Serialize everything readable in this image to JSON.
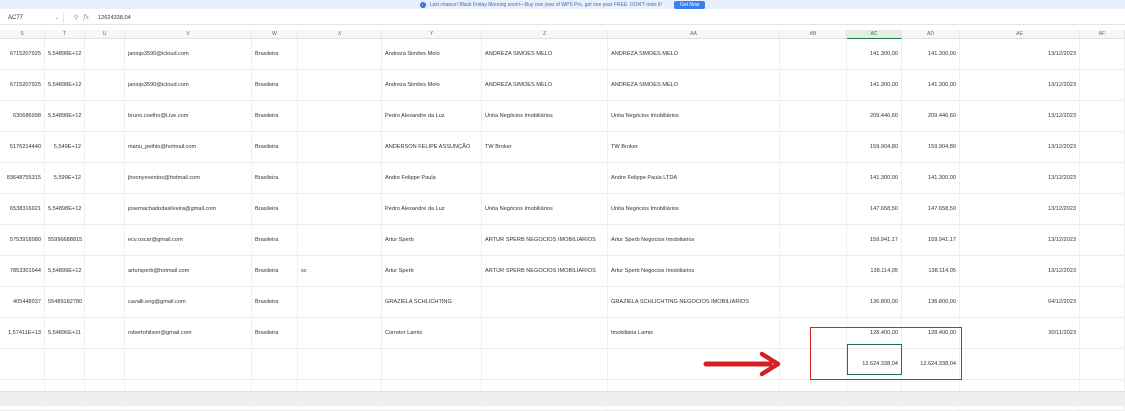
{
  "promo": {
    "text": "Last chance! Black Friday Mooring soon!—Buy one year of WPS Pro, get one year FREE. DON'T miss it!",
    "button": "Get Now"
  },
  "formula": {
    "cell_ref": "AC77",
    "fx": "fx",
    "value": "12624338,04"
  },
  "columns": [
    "S",
    "T",
    "U",
    "V",
    "W",
    "X",
    "Y",
    "Z",
    "AA",
    "AB",
    "AC",
    "AD",
    "AE",
    "AF"
  ],
  "active_column": "AC",
  "rows": [
    [
      "6715207925",
      "5,54898E+12",
      "",
      "janiojs3590@icloud.com",
      "Brasileira",
      "",
      "Andreza Simões Melo",
      "ANDREZA SIMOES MELO",
      "ANDREZA SIMOES MELO",
      "",
      "141.300,00",
      "141.300,00",
      "13/12/2023",
      ""
    ],
    [
      "6715207925",
      "5,54898E+12",
      "",
      "janiojs3590@icloud.com",
      "Brasileira",
      "",
      "Andreza Simões Melo",
      "ANDREZA SIMOES MELO",
      "ANDREZA SIMOES MELO",
      "",
      "141.300,00",
      "141.300,00",
      "13/12/2023",
      ""
    ],
    [
      "630686998",
      "5,54898E+12",
      "",
      "bruno.coelho@Live.com",
      "Brasileira",
      "",
      "Pedro Alexandre da Luz",
      "Unita Negócios Imobiliários",
      "Unita Negócios Imobiliários",
      "",
      "209.446,60",
      "209.446,60",
      "13/12/2023",
      ""
    ],
    [
      "5176214440",
      "5,549E+12",
      "",
      "manu_pethio@hotmail.com",
      "Brasileira",
      "",
      "ANDERSON FELIPE ASSUNÇÃO",
      "TW Broker",
      "TW Broker",
      "",
      "159.904,80",
      "159.904,80",
      "13/12/2023",
      ""
    ],
    [
      "83648755315",
      "5,599E+12",
      "",
      "jhoonyeventos@hotmail.com",
      "Brasileira",
      "",
      "Andre Felippe Paula",
      "",
      "Andre Felippe Paula LTDA",
      "",
      "141.300,00",
      "141.300,00",
      "13/12/2023",
      ""
    ],
    [
      "6538316921",
      "5,54898E+12",
      "",
      "josemachadodasilveira@gmail.com",
      "Brasileira",
      "",
      "Pedro Alexandre da Luz",
      "Unita Negócios Imobiliários",
      "Unita Negócios Imobiliários",
      "",
      "147.658,50",
      "147.658,50",
      "13/12/2023",
      ""
    ],
    [
      "5753918980",
      "55996688815",
      "",
      "ecv.oscar@gmail.com",
      "Brasileira",
      "",
      "Artur Sperb",
      "ARTUR SPERB NEGOCIOS IMOBILIARIOS",
      "Artur Sperb Negocios Imobiliarios",
      "",
      "159.941,17",
      "159.941,17",
      "13/12/2023",
      ""
    ],
    [
      "7853301944",
      "5,54899E+12",
      "",
      "artursperb@hotmail.com",
      "Brasileira",
      "sc",
      "Artur Sperb",
      "ARTUR SPERB NEGOCIOS IMOBILIARIOS",
      "Artur Sperb Negocios Imobiliarios",
      "",
      "138.114,05",
      "138.114,05",
      "13/12/2023",
      ""
    ],
    [
      "405448937",
      "55489182780",
      "",
      "cavalli.eng@gmail.com",
      "Brasileira",
      "",
      "GRAZIELA SCHLICHTING",
      "",
      "GRAZIELA SCHLICHTING NEGOCIOS IMOBILIARIOS",
      "",
      "136.800,00",
      "136.800,00",
      "04/12/2023",
      ""
    ],
    [
      "1,57411E+13",
      "5,54896E+11",
      "",
      "robertohilson@gmail.com",
      "Brasileira",
      "",
      "Corretor Lamis",
      "",
      "Imobiliária Lamis",
      "",
      "128.400,00",
      "128.400,00",
      "30/11/2023",
      ""
    ],
    [
      "",
      "",
      "",
      "",
      "",
      "",
      "",
      "",
      "",
      "",
      "12.624.338,04",
      "12.624.338,04",
      "",
      ""
    ],
    [
      "",
      "",
      "",
      "",
      "",
      "",
      "",
      "",
      "",
      "",
      "",
      "",
      "",
      ""
    ]
  ],
  "colors": {
    "accent": "#217346",
    "annotation": "#d42020"
  }
}
